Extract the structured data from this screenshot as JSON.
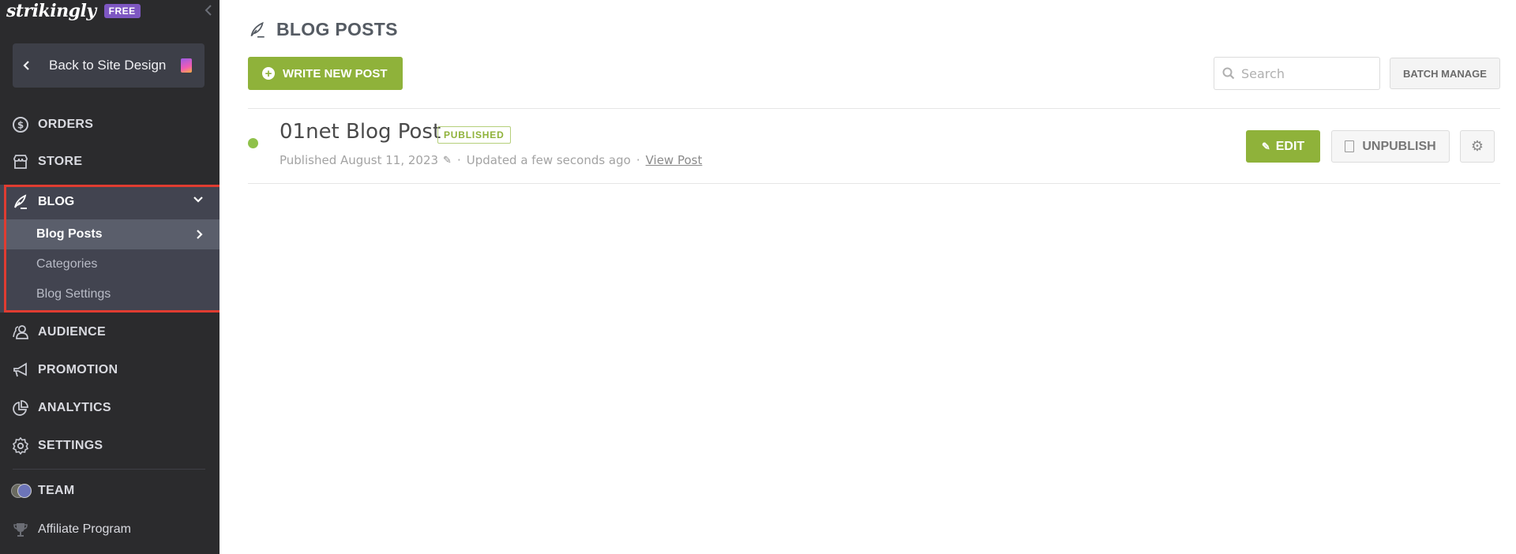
{
  "sidebar": {
    "logo": "strikingly",
    "plan_badge": "FREE",
    "collapse_icon": "chevron-left-icon",
    "back_button": {
      "label": "Back to Site Design",
      "icon": "chevron-left-icon",
      "doc_icon": "site-doc-icon"
    },
    "nav": [
      {
        "label": "ORDERS",
        "icon": "dollar-circle-icon"
      },
      {
        "label": "STORE",
        "icon": "store-icon"
      },
      {
        "label": "BLOG",
        "icon": "feather-pen-icon",
        "expanded": true
      },
      {
        "label": "AUDIENCE",
        "icon": "users-icon"
      },
      {
        "label": "PROMOTION",
        "icon": "megaphone-icon"
      },
      {
        "label": "ANALYTICS",
        "icon": "pie-chart-icon"
      },
      {
        "label": "SETTINGS",
        "icon": "gear-icon"
      },
      {
        "label": "TEAM",
        "icon": "team-avatars-icon"
      },
      {
        "label": "Affiliate Program",
        "icon": "trophy-icon"
      }
    ],
    "blog_submenu": [
      {
        "label": "Blog Posts",
        "active": true
      },
      {
        "label": "Categories",
        "active": false
      },
      {
        "label": "Blog Settings",
        "active": false
      }
    ]
  },
  "main": {
    "title": "BLOG POSTS",
    "write_button": "WRITE NEW POST",
    "search": {
      "placeholder": "Search",
      "value": ""
    },
    "batch_manage": "BATCH MANAGE",
    "posts": [
      {
        "title": "01net Blog Post",
        "status": "PUBLISHED",
        "published": "Published August 11, 2023",
        "updated": "Updated a few seconds ago",
        "view_link": "View Post",
        "separator": "·",
        "actions": {
          "edit": "EDIT",
          "unpublish": "UNPUBLISH"
        }
      }
    ]
  },
  "colors": {
    "sidebar_bg": "#2b2b2d",
    "blog_group_bg": "#424450",
    "active_sub_bg": "#5a5e6b",
    "accent_green": "#8fb23a",
    "badge_purple": "#7e57c2",
    "highlight_red": "#e03c31"
  }
}
